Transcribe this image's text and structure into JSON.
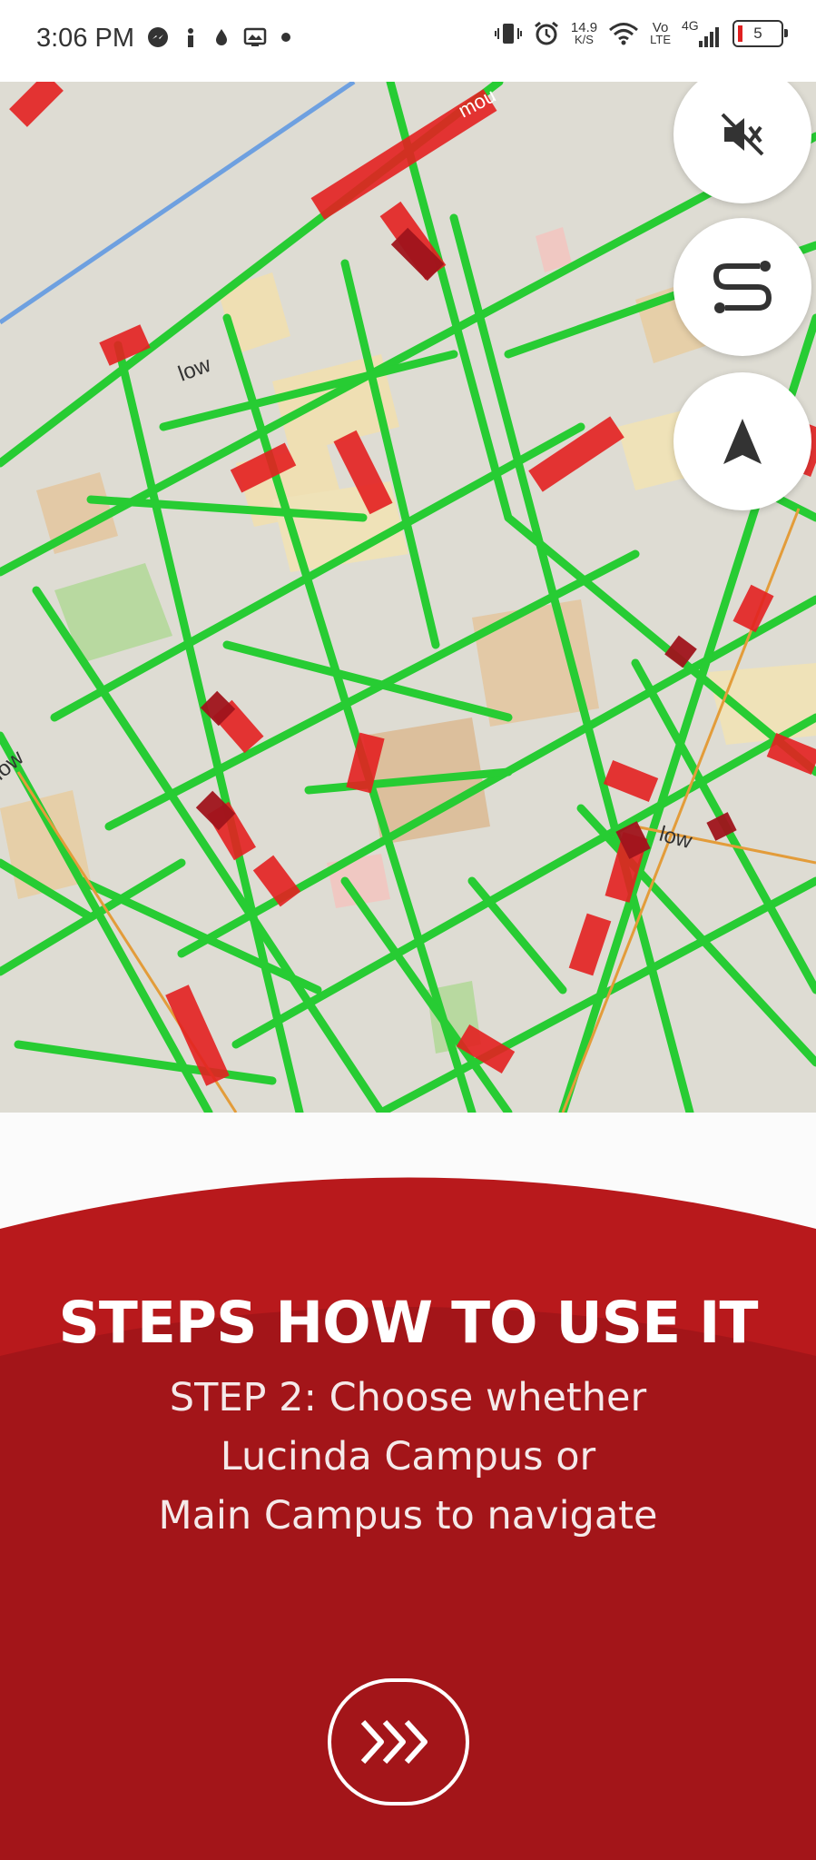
{
  "status_bar": {
    "time": "3:06 PM",
    "net_speed_top": "14.9",
    "net_speed_bottom": "K/S",
    "volte_top": "Vo",
    "volte_bottom": "LTE",
    "network": "4G",
    "battery": "5",
    "left_icons": [
      "messenger-icon",
      "info-icon",
      "drop-icon",
      "image-icon",
      "dot-icon"
    ],
    "right_icons": [
      "vibrate-icon",
      "alarm-icon",
      "wifi-icon",
      "signal-icon",
      "battery-icon"
    ]
  },
  "map": {
    "labels": [
      "low",
      "low",
      "low",
      "mou"
    ],
    "controls": [
      "mute-icon",
      "route-icon",
      "navigation-arrow-icon"
    ]
  },
  "onboarding": {
    "title": "STEPS HOW TO USE IT",
    "step_line1": "STEP 2: Choose whether",
    "step_line2": "Lucinda Campus or",
    "step_line3": "Main Campus to navigate",
    "next_icon": "triple-chevron-right-icon"
  },
  "colors": {
    "brand_red": "#b8191c",
    "brand_red_dark": "#a31519",
    "traffic_green": "#22cc33",
    "traffic_red": "#e42121",
    "map_bg": "#dedcd3"
  }
}
